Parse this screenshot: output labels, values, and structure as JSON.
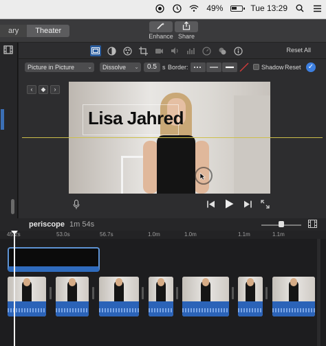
{
  "menubar": {
    "battery_percent": "49%",
    "clock": "Tue 13:29"
  },
  "toolbar": {
    "tabs": [
      "ary",
      "Theater"
    ],
    "enhance_label": "Enhance",
    "share_label": "Share"
  },
  "adjustments": {
    "reset_all_label": "Reset All"
  },
  "overlay": {
    "mode": "Picture in Picture",
    "transition": "Dissolve",
    "duration": "0.5",
    "duration_unit": "s",
    "border_label": "Border:",
    "shadow_label": "Shadow",
    "reset_label": "Reset"
  },
  "viewer": {
    "title_text": "Lisa Jahred"
  },
  "timeline": {
    "project_name": "periscope",
    "project_duration": "1m 54s",
    "ruler_ticks": [
      "45.2s",
      "53.0s",
      "56.7s",
      "1.0m",
      "1.0m",
      "1.1m",
      "1.1m"
    ]
  },
  "colors": {
    "accent": "#3d7fe0",
    "audio": "#2b63b8",
    "title_clip": "#5e93d4",
    "guide_line": "#cdbf4a"
  }
}
